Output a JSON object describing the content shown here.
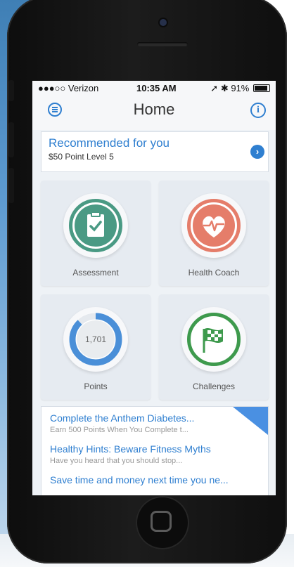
{
  "status_bar": {
    "carrier": "●●●○○ Verizon",
    "time": "10:35 AM",
    "battery": "91%"
  },
  "nav": {
    "title": "Home"
  },
  "recommended": {
    "title": "Recommended for you",
    "subtitle": "$50 Point Level 5"
  },
  "tiles": [
    {
      "label": "Assessment",
      "icon": "clipboard-check-icon",
      "color": "#4a9a84"
    },
    {
      "label": "Health Coach",
      "icon": "heart-pulse-icon",
      "color": "#e57d6a"
    },
    {
      "label": "Points",
      "value": "1,701",
      "progress": 0.88,
      "color": "#4a8fd8"
    },
    {
      "label": "Challenges",
      "icon": "checkered-flag-icon",
      "color": "#3e9a4d"
    }
  ],
  "feed": [
    {
      "title": "Complete the Anthem Diabetes...",
      "subtitle": "Earn 500 Points When You Complete t..."
    },
    {
      "title": "Healthy Hints: Beware Fitness Myths",
      "subtitle": "Have you heard that you should stop..."
    },
    {
      "title": "Save time and money next time you ne...",
      "subtitle": ""
    }
  ],
  "colors": {
    "accent": "#2f7fd0",
    "background": "#eef2f6"
  }
}
